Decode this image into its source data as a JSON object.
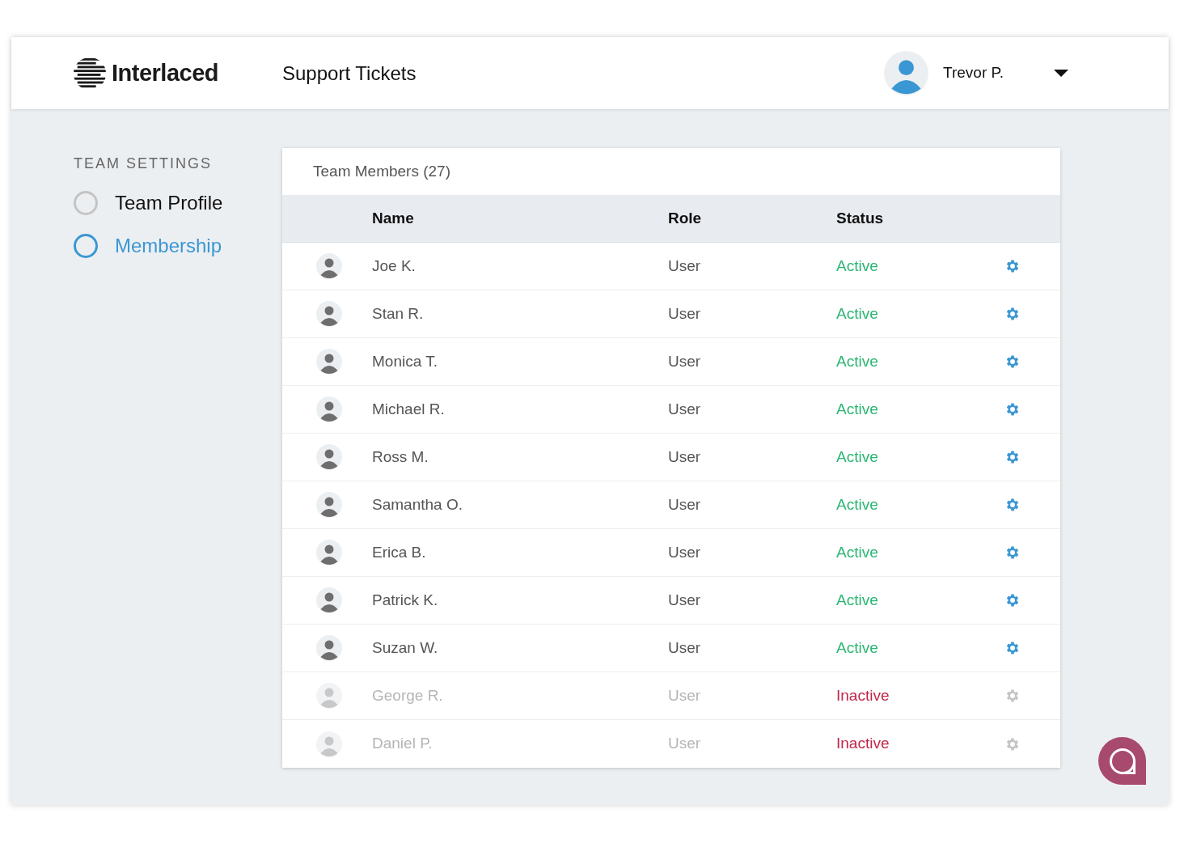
{
  "header": {
    "brand": "Interlaced",
    "page_title": "Support Tickets",
    "user": {
      "name": "Trevor P."
    }
  },
  "sidebar": {
    "heading": "TEAM SETTINGS",
    "items": [
      {
        "label": "Team Profile",
        "selected": false
      },
      {
        "label": "Membership",
        "selected": true
      }
    ]
  },
  "table": {
    "title": "Team Members (27)",
    "columns": [
      "Name",
      "Role",
      "Status"
    ],
    "rows": [
      {
        "name": "Joe K.",
        "role": "User",
        "status": "Active",
        "active": true
      },
      {
        "name": "Stan R.",
        "role": "User",
        "status": "Active",
        "active": true
      },
      {
        "name": "Monica T.",
        "role": "User",
        "status": "Active",
        "active": true
      },
      {
        "name": "Michael R.",
        "role": "User",
        "status": "Active",
        "active": true
      },
      {
        "name": "Ross M.",
        "role": "User",
        "status": "Active",
        "active": true
      },
      {
        "name": "Samantha O.",
        "role": "User",
        "status": "Active",
        "active": true
      },
      {
        "name": "Erica B.",
        "role": "User",
        "status": "Active",
        "active": true
      },
      {
        "name": "Patrick K.",
        "role": "User",
        "status": "Active",
        "active": true
      },
      {
        "name": "Suzan W.",
        "role": "User",
        "status": "Active",
        "active": true
      },
      {
        "name": "George R.",
        "role": "User",
        "status": "Inactive",
        "active": false
      },
      {
        "name": "Daniel P.",
        "role": "User",
        "status": "Inactive",
        "active": false
      }
    ]
  }
}
